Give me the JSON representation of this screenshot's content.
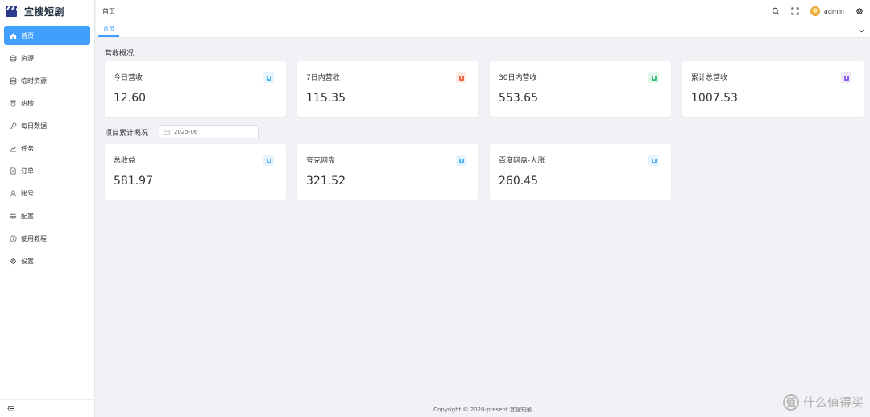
{
  "app": {
    "title": "宜搜短剧"
  },
  "sidebar": {
    "items": [
      {
        "label": "首页",
        "icon": "home-icon",
        "active": true
      },
      {
        "label": "资源",
        "icon": "database-icon",
        "active": false
      },
      {
        "label": "临时资源",
        "icon": "database-icon",
        "active": false
      },
      {
        "label": "热榜",
        "icon": "medal-icon",
        "active": false
      },
      {
        "label": "每日数据",
        "icon": "key-icon",
        "active": false
      },
      {
        "label": "任务",
        "icon": "chart-icon",
        "active": false
      },
      {
        "label": "订单",
        "icon": "document-icon",
        "active": false
      },
      {
        "label": "账号",
        "icon": "user-icon",
        "active": false
      },
      {
        "label": "配置",
        "icon": "sliders-icon",
        "active": false
      },
      {
        "label": "使用教程",
        "icon": "info-icon",
        "active": false
      },
      {
        "label": "设置",
        "icon": "gear-icon",
        "active": false
      }
    ]
  },
  "header": {
    "breadcrumb": "首页",
    "username": "admin"
  },
  "tabs": [
    {
      "label": "首页",
      "active": true
    }
  ],
  "revenue": {
    "section_title": "营收概况",
    "cards": [
      {
        "title": "今日营收",
        "value": "12.60",
        "icon_color": "#4db3f5"
      },
      {
        "title": "7日内营收",
        "value": "115.35",
        "icon_color": "#f0623b"
      },
      {
        "title": "30日内营收",
        "value": "553.65",
        "icon_color": "#34c27b"
      },
      {
        "title": "累计总营收",
        "value": "1007.53",
        "icon_color": "#8a5cf0"
      }
    ]
  },
  "projects": {
    "section_title": "项目累计概况",
    "date_value": "2025-06",
    "cards": [
      {
        "title": "总收益",
        "value": "581.97",
        "icon_color": "#4db3f5"
      },
      {
        "title": "夸克网盘",
        "value": "321.52",
        "icon_color": "#4db3f5"
      },
      {
        "title": "百度网盘-大涨",
        "value": "260.45",
        "icon_color": "#4db3f5"
      }
    ]
  },
  "footer": {
    "text": "Copyright © 2020-present 宜搜短剧"
  },
  "watermark": {
    "logo_text": "值",
    "text": "什么值得买"
  }
}
